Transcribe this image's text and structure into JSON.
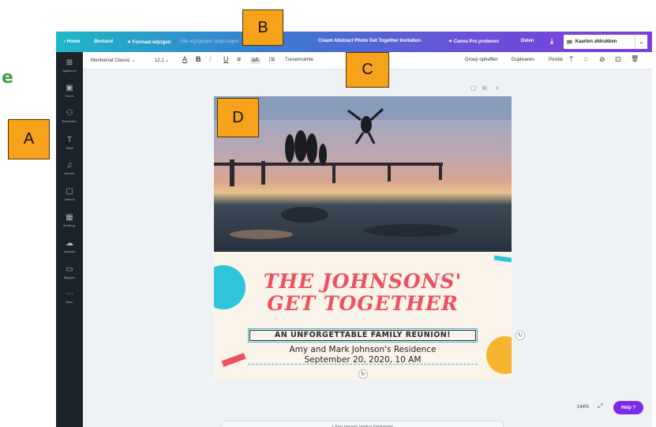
{
  "edge_letter": "e",
  "callouts": {
    "a": "A",
    "b": "B",
    "c": "C",
    "d": "D"
  },
  "topbar": {
    "home": "‹  Home",
    "file": "Bestand",
    "resize": "✦ Formaat wijzigen",
    "saved": "Alle wijzigingen opgeslagen",
    "doc_title": "Cream Abstract Photo Get Together Invitation",
    "pro": "✦ Canva Pro proberen",
    "share": "Delen",
    "download_icon": "⤓",
    "print_icon": "✉",
    "print": "Kaarten afdrukken",
    "print_arrow": "⌄"
  },
  "sidebar": {
    "items": [
      {
        "icon": "⊞",
        "label": "Sjablonen"
      },
      {
        "icon": "▣",
        "label": "Foto's"
      },
      {
        "icon": "⚇",
        "label": "Elementen"
      },
      {
        "icon": "T",
        "label": "Tekst"
      },
      {
        "icon": "♫",
        "label": "Muziek"
      },
      {
        "icon": "▢",
        "label": "Video's"
      },
      {
        "icon": "▦",
        "label": "Achtergr."
      },
      {
        "icon": "☁",
        "label": "Uploads"
      },
      {
        "icon": "▭",
        "label": "Mappen"
      },
      {
        "icon": "⋯",
        "label": "Meer"
      }
    ]
  },
  "toolbar": {
    "font": "Montserrat Classic  ⌄",
    "size": "12,1  ⌄",
    "color_a": "A",
    "bold": "B",
    "italic": "I",
    "underline": "U",
    "strike": "≡",
    "case": "aA",
    "list": "⁝≡",
    "spacing": "Tussenruimte",
    "ungroup": "Groep opheffen",
    "duplicate": "Dupliceren",
    "position": "Positie",
    "paint_icon": "⍑",
    "transparency_icon": "⁙",
    "link_icon": "⊘",
    "lock_icon": "⊡",
    "delete_icon": "🗑"
  },
  "page_tools": {
    "note": "▢",
    "copy": "⧉",
    "add": "+"
  },
  "invitation": {
    "heading_line1": "THE JOHNSONS'",
    "heading_line2": "GET TOGETHER",
    "banner": "AN UNFORGETTABLE FAMILY REUNION!",
    "address": "Amy and Mark Johnson's Residence",
    "date": "September 20, 2020, 10 AM",
    "rotate_icon": "↻",
    "side_rotate_icon": "↻"
  },
  "add_page": "+ Een nieuwe pagina toevoegen",
  "zoom": {
    "level": "144%",
    "expand_icon": "⤢"
  },
  "help": "Help ?",
  "colors": {
    "heading": "#ef4f5f",
    "topbar_start": "#1fb7c7",
    "topbar_end": "#7b3fe0",
    "sidebar": "#1c2229",
    "help": "#7d2ae8",
    "callout": "#f7a21b"
  }
}
